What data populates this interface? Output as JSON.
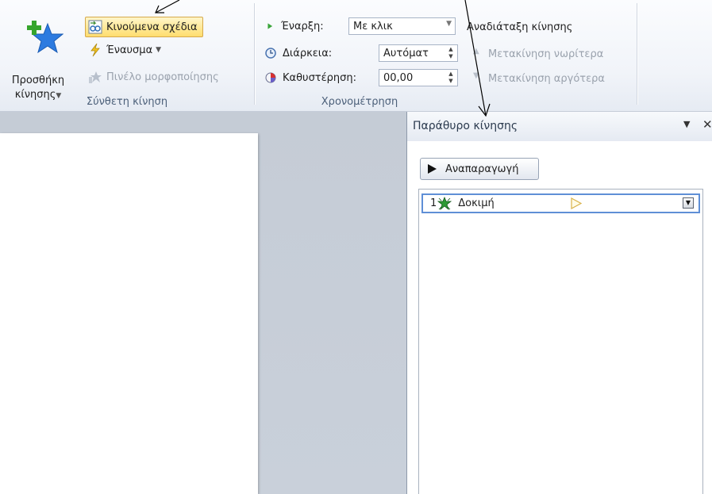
{
  "ribbon": {
    "advanced_animation": {
      "add_animation_label_line1": "Προσθήκη",
      "add_animation_label_line2": "κίνησης",
      "motion_paths_label": "Κινούμενα σχέδια",
      "trigger_label": "Έναυσμα",
      "animation_painter_label": "Πινέλο μορφοποίησης",
      "group_label": "Σύνθετη κίνηση"
    },
    "timing": {
      "start_label": "Έναρξη:",
      "start_value": "Με κλικ",
      "duration_label": "Διάρκεια:",
      "duration_value": "Αυτόματ",
      "delay_label": "Καθυστέρηση:",
      "delay_value": "00,00",
      "group_label": "Χρονομέτρηση"
    },
    "reorder": {
      "title": "Αναδιάταξη κίνησης",
      "move_earlier_label": "Μετακίνηση νωρίτερα",
      "move_later_label": "Μετακίνηση αργότερα"
    }
  },
  "pane": {
    "title": "Παράθυρο κίνησης",
    "menu_glyph": "▼",
    "close_glyph": "✕",
    "play_label": "Αναπαραγωγή",
    "items": [
      {
        "number": "1",
        "name": "Δοκιμή",
        "icon": "star-effect-icon"
      }
    ]
  },
  "colors": {
    "ribbon_label": "#4c607a",
    "highlight": "#ffdd6e",
    "selection_border": "#5f8fd6",
    "workspace": "#c5ccd6"
  }
}
